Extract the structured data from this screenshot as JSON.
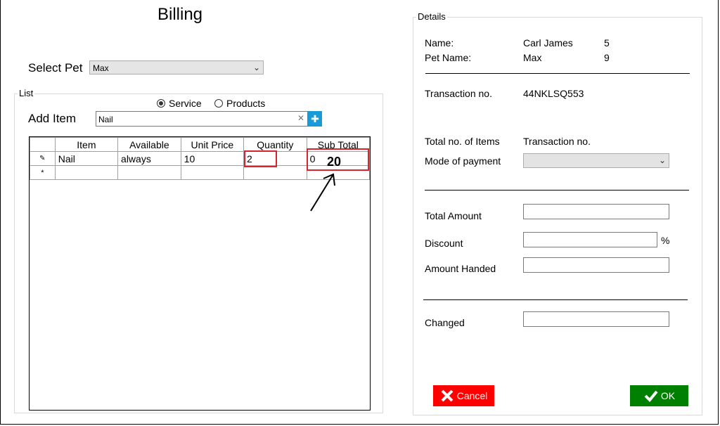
{
  "window": {
    "title": "Billing"
  },
  "select_pet": {
    "label": "Select Pet",
    "value": "Max"
  },
  "list_group": {
    "legend": "List",
    "radio_service": "Service",
    "radio_products": "Products",
    "add_item_label": "Add Item",
    "add_item_value": "Nail",
    "clear_glyph": "✕",
    "add_glyph": "✚"
  },
  "grid": {
    "columns": [
      "Item",
      "Available",
      "Unit Price",
      "Quantity",
      "Sub Total"
    ],
    "rows": [
      {
        "marker": "✎",
        "item": "Nail",
        "available": "always",
        "unit_price": "10",
        "quantity": "2",
        "sub_total": "0"
      }
    ],
    "new_row_marker": "*"
  },
  "annotation": {
    "text": "20"
  },
  "details": {
    "legend": "Details",
    "name_label": "Name:",
    "name_value": "Carl James",
    "name_num": "5",
    "pet_name_label": "Pet Name:",
    "pet_name_value": "Max",
    "pet_name_num": "9",
    "transaction_label": "Transaction no.",
    "transaction_value": "44NKLSQ553",
    "total_items_label": "Total no. of Items",
    "total_items_value": "Transaction no.",
    "mode_payment_label": "Mode of payment",
    "total_amount_label": "Total Amount",
    "discount_label": "Discount",
    "discount_unit": "%",
    "amount_handed_label": "Amount Handed",
    "changed_label": "Changed"
  },
  "buttons": {
    "cancel": "Cancel",
    "ok": "OK",
    "cancel_color": "#ff0000",
    "ok_color": "#008000"
  }
}
